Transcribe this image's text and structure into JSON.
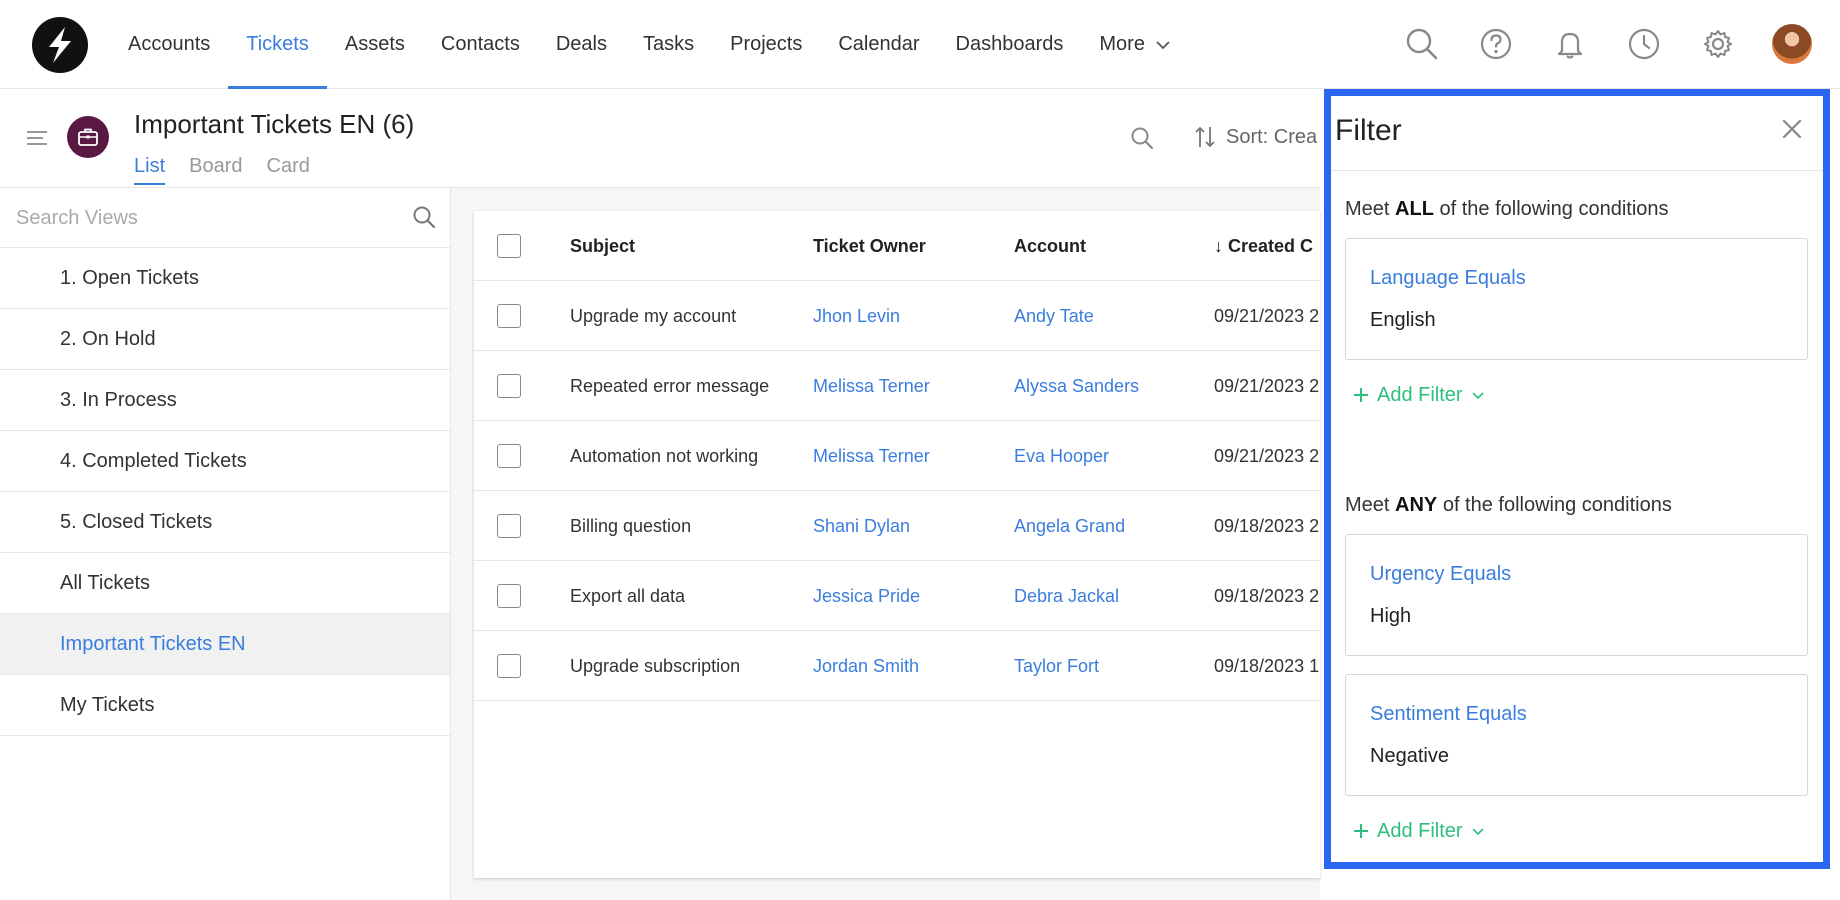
{
  "nav": {
    "items": [
      {
        "label": "Accounts"
      },
      {
        "label": "Tickets",
        "active": true
      },
      {
        "label": "Assets"
      },
      {
        "label": "Contacts"
      },
      {
        "label": "Deals"
      },
      {
        "label": "Tasks"
      },
      {
        "label": "Projects"
      },
      {
        "label": "Calendar"
      },
      {
        "label": "Dashboards"
      }
    ],
    "more_label": "More",
    "icons": [
      "search-icon",
      "help-icon",
      "bell-icon",
      "clock-icon",
      "gear-icon"
    ],
    "accent_color": "#3b7ddd"
  },
  "header": {
    "title": "Important Tickets EN  (6)",
    "tabs": [
      {
        "label": "List",
        "active": true
      },
      {
        "label": "Board"
      },
      {
        "label": "Card"
      }
    ],
    "sort_label": "Sort: Crea"
  },
  "sidebar": {
    "search_placeholder": "Search Views",
    "views": [
      {
        "label": "1. Open Tickets"
      },
      {
        "label": "2. On Hold"
      },
      {
        "label": "3. In Process"
      },
      {
        "label": "4. Completed Tickets"
      },
      {
        "label": "5. Closed Tickets"
      },
      {
        "label": "All Tickets"
      },
      {
        "label": "Important Tickets EN",
        "active": true
      },
      {
        "label": "My Tickets"
      }
    ]
  },
  "table": {
    "columns": {
      "subject": "Subject",
      "owner": "Ticket Owner",
      "account": "Account",
      "created": "↓ Created C"
    },
    "rows": [
      {
        "subject": "Upgrade my account",
        "owner": "Jhon Levin",
        "account": "Andy Tate",
        "created": "09/21/2023 2"
      },
      {
        "subject": "Repeated error message",
        "owner": "Melissa Terner",
        "account": "Alyssa Sanders",
        "created": "09/21/2023 2"
      },
      {
        "subject": "Automation not working",
        "owner": "Melissa Terner",
        "account": "Eva Hooper",
        "created": "09/21/2023 2"
      },
      {
        "subject": "Billing question",
        "owner": "Shani Dylan",
        "account": "Angela Grand",
        "created": "09/18/2023 2"
      },
      {
        "subject": "Export all data",
        "owner": "Jessica Pride",
        "account": "Debra Jackal",
        "created": "09/18/2023 2"
      },
      {
        "subject": "Upgrade subscription",
        "owner": "Jordan Smith",
        "account": "Taylor Fort",
        "created": "09/18/2023 1"
      }
    ]
  },
  "filter": {
    "title": "Filter",
    "all_group": {
      "prefix": "Meet ",
      "keyword": "ALL",
      "suffix": " of the following conditions",
      "conditions": [
        {
          "field": "Language Equals",
          "value": "English"
        }
      ],
      "add_label": "Add Filter"
    },
    "any_group": {
      "prefix": "Meet ",
      "keyword": "ANY",
      "suffix": " of the following conditions",
      "conditions": [
        {
          "field": "Urgency Equals",
          "value": "High"
        },
        {
          "field": "Sentiment Equals",
          "value": "Negative"
        }
      ],
      "add_label": "Add Filter"
    },
    "border_color": "#2a66f0",
    "add_color": "#2dbf7c"
  }
}
